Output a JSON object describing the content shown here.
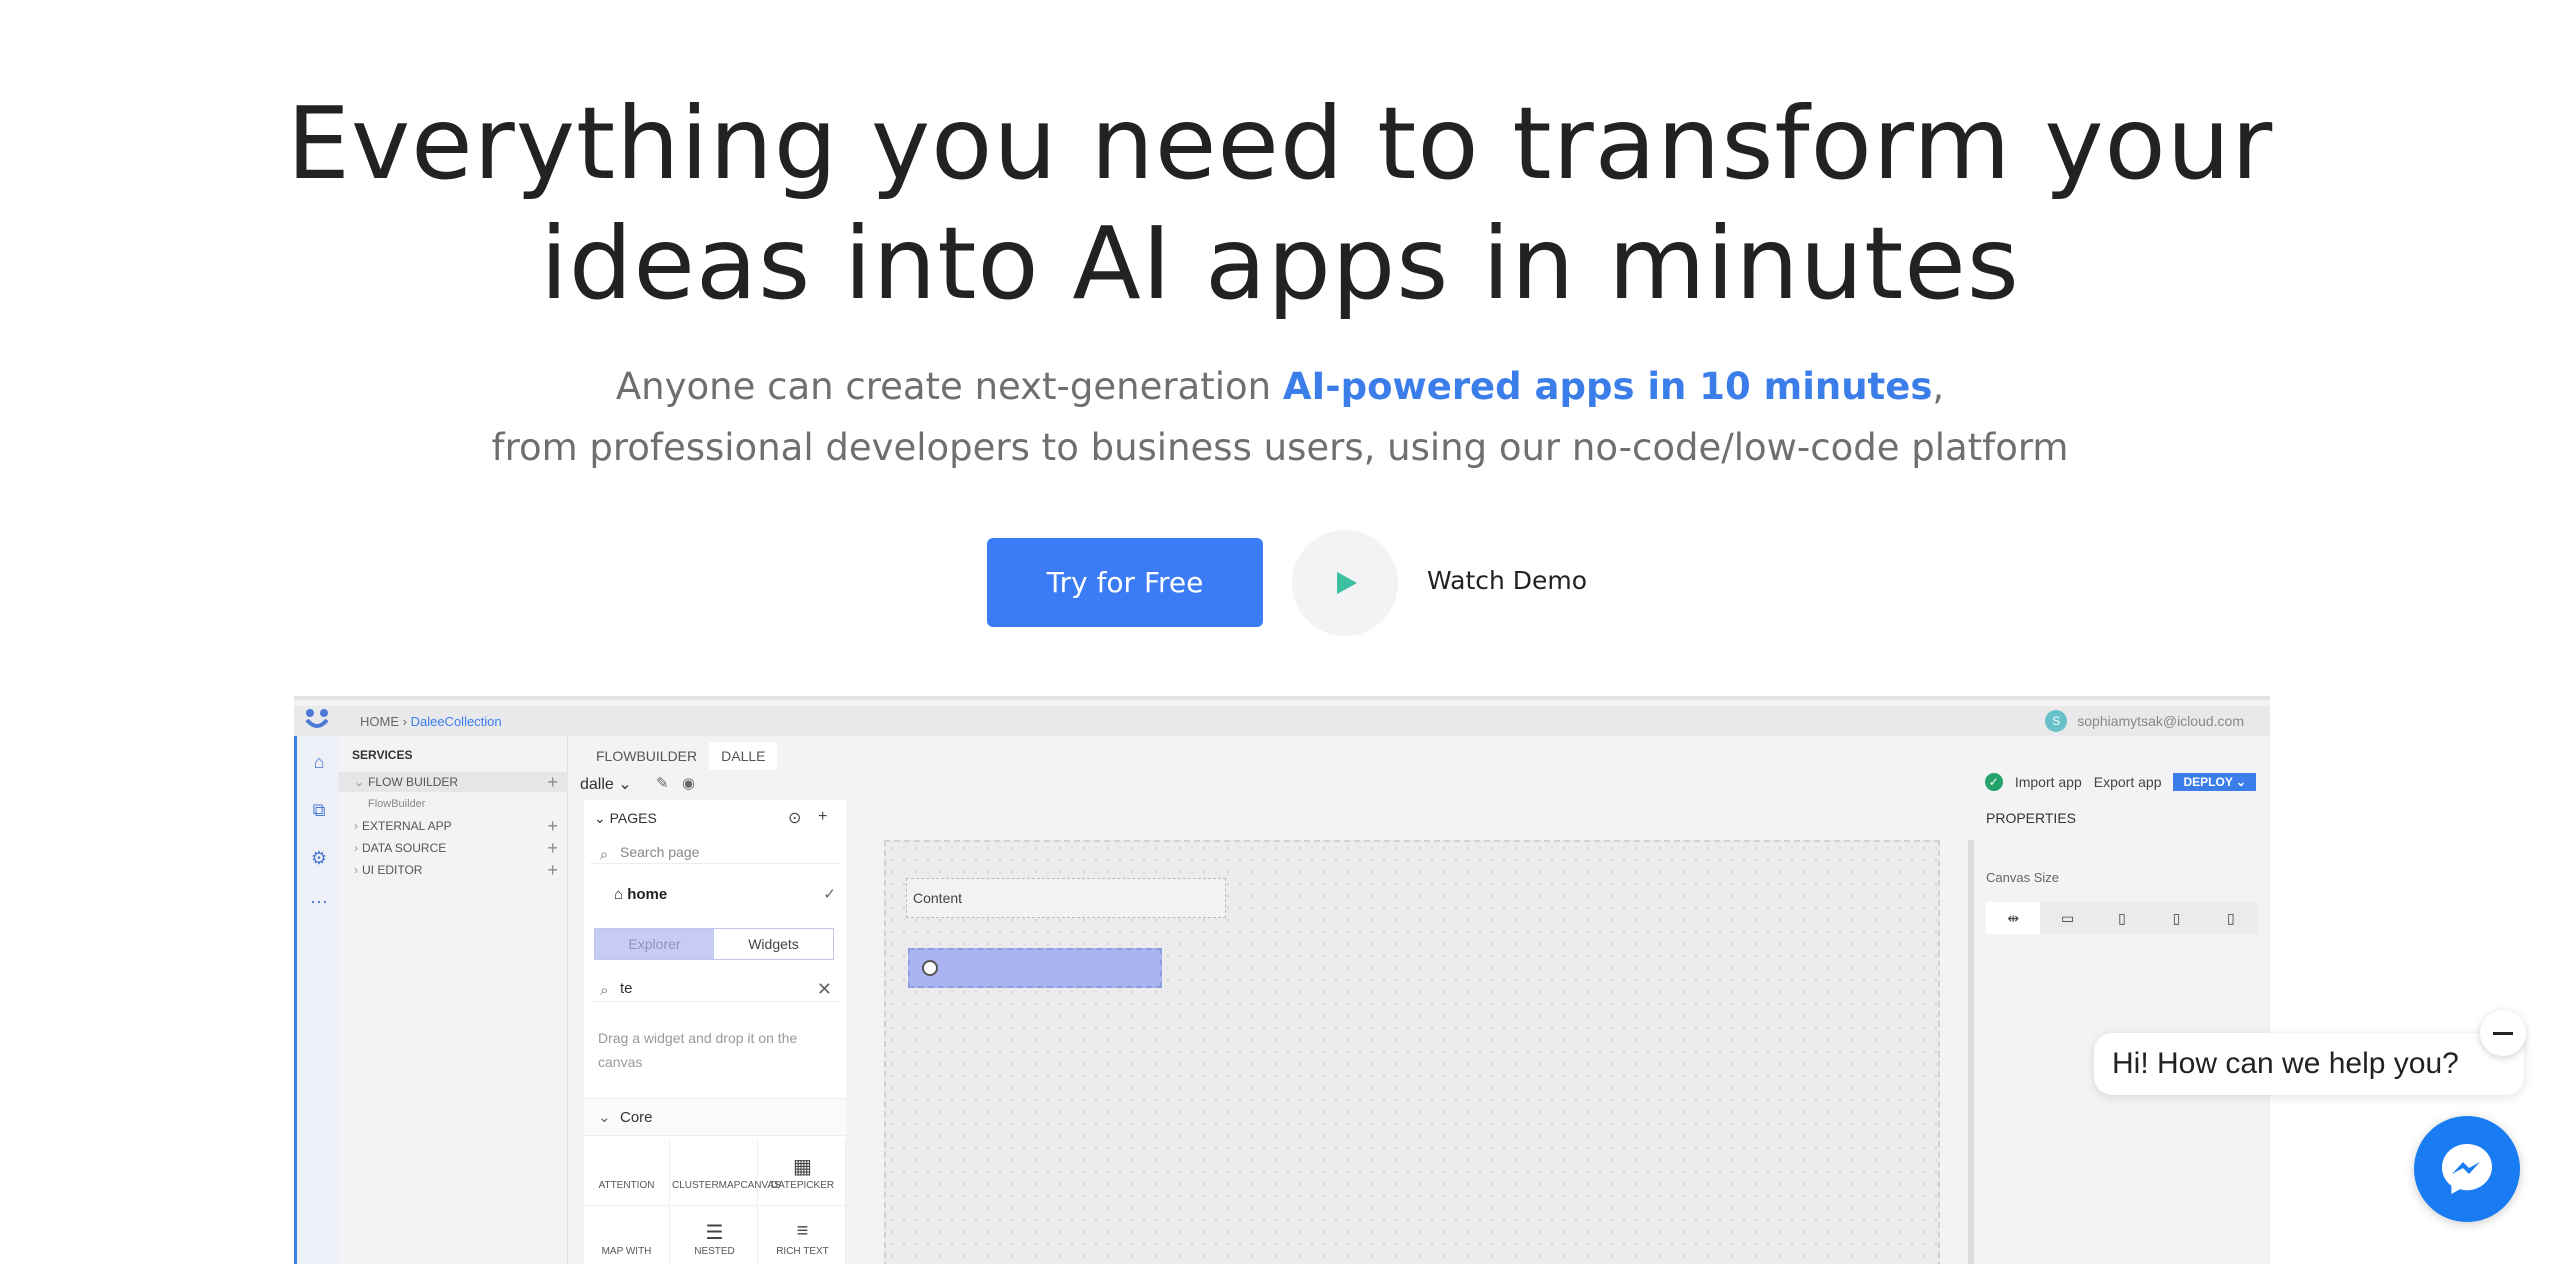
{
  "hero": {
    "title_line1": "Everything you need to transform your",
    "title_line2": "ideas into AI apps in minutes",
    "sub_prefix": "Anyone can create next-generation ",
    "sub_highlight": "AI-powered apps in 10 minutes",
    "sub_suffix": ",",
    "sub_line2": "from professional developers to business users, using our no-code/low-code platform",
    "cta_label": "Try for Free",
    "watch_label": "Watch Demo",
    "accent_color": "#3b7cf6"
  },
  "app": {
    "breadcrumb_home": "HOME",
    "breadcrumb_sep": "›",
    "breadcrumb_current": "DaleeCollection",
    "user_initial": "S",
    "user_email": "sophiamytsak@icloud.com",
    "services_header": "SERVICES",
    "services": [
      {
        "label": "FLOW BUILDER",
        "caret": "⌄"
      },
      {
        "label": "FlowBuilder",
        "caret": ""
      },
      {
        "label": "EXTERNAL APP",
        "caret": "›"
      },
      {
        "label": "DATA SOURCE",
        "caret": "›"
      },
      {
        "label": "UI EDITOR",
        "caret": "›"
      }
    ],
    "tabs": [
      "FLOWBUILDER",
      "DALLE"
    ],
    "app_name": "dalle",
    "import_label": "Import app",
    "export_label": "Export app",
    "deploy_label": "DEPLOY",
    "pages_header": "PAGES",
    "search_page_placeholder": "Search page",
    "page_home": "home",
    "toggle_explorer": "Explorer",
    "toggle_widgets": "Widgets",
    "widget_search_value": "te",
    "drag_hint": "Drag a widget and drop it on the canvas",
    "core_label": "Core",
    "widgets": [
      "ATTENTION",
      "CLUSTERMAPCANVAS",
      "DATEPICKER",
      "MAP WITH",
      "NESTED",
      "RICH TEXT"
    ],
    "canvas_content_label": "Content",
    "properties_header": "PROPERTIES",
    "canvas_size_label": "Canvas Size"
  },
  "chat": {
    "greeting": "Hi! How can we help you?",
    "messenger_color": "#1a7cf2"
  }
}
